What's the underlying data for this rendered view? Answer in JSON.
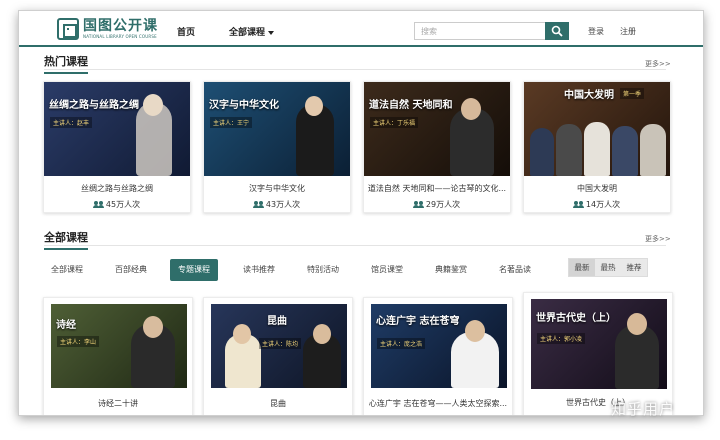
{
  "header": {
    "logo_cn": "国图公开课",
    "logo_en": "NATIONAL LIBRARY OPEN COURSE",
    "nav": [
      {
        "label": "首页"
      },
      {
        "label": "全部课程"
      }
    ],
    "search_placeholder": "搜索",
    "login_label": "登录",
    "register_label": "注册"
  },
  "hot": {
    "title": "热门课程",
    "more": "更多>>",
    "cards": [
      {
        "thumb_title": "丝绸之路与丝路之绸",
        "thumb_sub": "主讲人：赵丰",
        "name": "丝绸之路与丝路之绸",
        "views": "45万人次",
        "bg": "#1d2a4a"
      },
      {
        "thumb_title": "汉字与中华文化",
        "thumb_sub": "主讲人：王宁",
        "name": "汉字与中华文化",
        "views": "43万人次",
        "bg": "#13324f"
      },
      {
        "thumb_title": "道法自然 天地同和",
        "thumb_sub": "主讲人：丁乐福",
        "name": "道法自然 天地同和——论古琴的文化...",
        "views": "29万人次",
        "bg": "#2a1f16"
      },
      {
        "thumb_title": "中国大发明",
        "thumb_sub": "第一季",
        "name": "中国大发明",
        "views": "14万人次",
        "bg": "#3a2418"
      }
    ]
  },
  "all": {
    "title": "全部课程",
    "more": "更多>>",
    "categories": [
      {
        "label": "全部课程",
        "active": false
      },
      {
        "label": "百部经典",
        "active": false
      },
      {
        "label": "专题课程",
        "active": true
      },
      {
        "label": "读书推荐",
        "active": false
      },
      {
        "label": "特别活动",
        "active": false
      },
      {
        "label": "馆员课堂",
        "active": false
      },
      {
        "label": "典籍鉴赏",
        "active": false
      },
      {
        "label": "名著品读",
        "active": false
      }
    ],
    "sort": [
      {
        "label": "最新",
        "active": true
      },
      {
        "label": "最热",
        "active": false
      },
      {
        "label": "推荐",
        "active": false
      }
    ],
    "cards": [
      {
        "thumb_title": "诗经",
        "thumb_sub": "主讲人：李山",
        "name": "诗经二十讲",
        "bg": "#3c4a2a"
      },
      {
        "thumb_title": "昆曲",
        "thumb_sub": "主讲人：陈均",
        "name": "昆曲",
        "bg": "#1f2a44"
      },
      {
        "thumb_title": "心连广宇 志在苍穹",
        "thumb_sub": "主讲人：庞之浩",
        "name": "心连广宇 志在苍穹——人类太空探索...",
        "bg": "#132848"
      },
      {
        "thumb_title": "世界古代史（上）",
        "thumb_sub": "主讲人：郭小凌",
        "name": "世界古代史（上）",
        "bg": "#2a2030"
      }
    ]
  },
  "watermark": "知乎用户"
}
